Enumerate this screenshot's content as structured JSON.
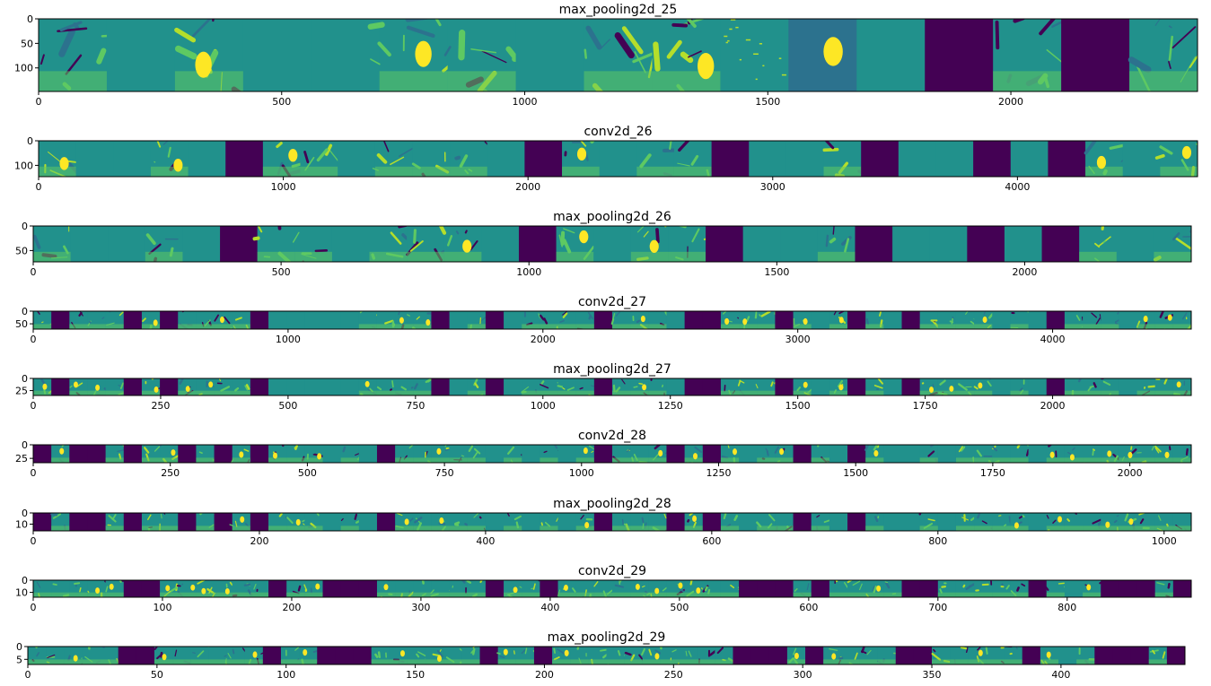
{
  "colors": {
    "dark": "#440154",
    "teal": "#21918c",
    "mid": "#2c728e",
    "green": "#5ec962",
    "lime": "#b5de2b",
    "yellow": "#fde725"
  },
  "chart_data": [
    {
      "type": "heatmap",
      "title": "max_pooling2d_25",
      "xlim": [
        0,
        2384
      ],
      "ylim": [
        148,
        0
      ],
      "xticks": [
        0,
        500,
        1000,
        1500,
        2000
      ],
      "yticks": [
        0,
        50,
        100
      ],
      "panels": [
        "feat",
        "flat",
        "feat",
        "flat",
        "flat",
        "feat",
        "feat",
        "flat",
        "feat",
        "feat",
        "sparse",
        "blob",
        "flat",
        "dark",
        "feat",
        "dark",
        "feat"
      ]
    },
    {
      "type": "heatmap",
      "title": "conv2d_26",
      "xlim": [
        0,
        4736
      ],
      "ylim": [
        146,
        0
      ],
      "xticks": [
        0,
        1000,
        2000,
        3000,
        4000
      ],
      "yticks": [
        0,
        100
      ],
      "panels": [
        "feat",
        "flat",
        "flat",
        "feat",
        "flat",
        "dark",
        "feat",
        "feat",
        "flat",
        "feat",
        "feat",
        "feat",
        "flat",
        "dark",
        "feat",
        "flat",
        "feat",
        "feat",
        "dark",
        "flat",
        "flat",
        "feat",
        "dark",
        "flat",
        "flat",
        "dark",
        "flat",
        "dark",
        "feat",
        "flat",
        "feat"
      ]
    },
    {
      "type": "heatmap",
      "title": "max_pooling2d_26",
      "xlim": [
        0,
        2336
      ],
      "ylim": [
        73,
        0
      ],
      "xticks": [
        0,
        500,
        1000,
        1500,
        2000
      ],
      "yticks": [
        0,
        50
      ],
      "panels": [
        "feat",
        "flat",
        "flat",
        "feat",
        "flat",
        "dark",
        "feat",
        "feat",
        "flat",
        "feat",
        "feat",
        "feat",
        "flat",
        "dark",
        "feat",
        "flat",
        "feat",
        "feat",
        "dark",
        "flat",
        "flat",
        "feat",
        "dark",
        "flat",
        "flat",
        "dark",
        "flat",
        "dark",
        "feat",
        "flat",
        "feat"
      ]
    },
    {
      "type": "heatmap",
      "title": "conv2d_27",
      "xlim": [
        0,
        4544
      ],
      "ylim": [
        71,
        0
      ],
      "xticks": [
        0,
        1000,
        2000,
        3000,
        4000
      ],
      "yticks": [
        0,
        50
      ],
      "panels": [
        "feat",
        "dark",
        "feat",
        "feat",
        "feat",
        "dark",
        "feat",
        "dark",
        "feat",
        "feat",
        "feat",
        "feat",
        "dark",
        "flat",
        "flat",
        "flat",
        "flat",
        "flat",
        "feat",
        "feat",
        "feat",
        "feat",
        "dark",
        "flat",
        "feat",
        "dark",
        "flat",
        "feat",
        "feat",
        "feat",
        "feat",
        "dark",
        "feat",
        "feat",
        "feat",
        "flat",
        "dark",
        "dark",
        "feat",
        "feat",
        "feat",
        "dark",
        "feat",
        "flat",
        "feat",
        "dark",
        "feat",
        "flat",
        "dark",
        "feat",
        "feat",
        "feat",
        "feat",
        "flat",
        "feat",
        "flat",
        "dark",
        "feat",
        "feat",
        "feat",
        "flat",
        "feat",
        "feat",
        "feat"
      ]
    },
    {
      "type": "heatmap",
      "title": "max_pooling2d_27",
      "xlim": [
        0,
        2272
      ],
      "ylim": [
        35,
        0
      ],
      "xticks": [
        0,
        250,
        500,
        750,
        1000,
        1250,
        1500,
        1750,
        2000
      ],
      "yticks": [
        0,
        25
      ],
      "panels": [
        "feat",
        "dark",
        "feat",
        "feat",
        "feat",
        "dark",
        "feat",
        "dark",
        "feat",
        "feat",
        "feat",
        "feat",
        "dark",
        "flat",
        "flat",
        "flat",
        "flat",
        "flat",
        "feat",
        "feat",
        "feat",
        "feat",
        "dark",
        "flat",
        "feat",
        "dark",
        "flat",
        "feat",
        "feat",
        "feat",
        "feat",
        "dark",
        "feat",
        "feat",
        "feat",
        "flat",
        "dark",
        "dark",
        "feat",
        "feat",
        "feat",
        "dark",
        "feat",
        "flat",
        "feat",
        "dark",
        "feat",
        "flat",
        "dark",
        "feat",
        "feat",
        "feat",
        "feat",
        "flat",
        "feat",
        "flat",
        "dark",
        "feat",
        "feat",
        "feat",
        "flat",
        "feat",
        "feat",
        "feat"
      ]
    },
    {
      "type": "heatmap",
      "title": "conv2d_28",
      "xlim": [
        0,
        2112
      ],
      "ylim": [
        33,
        0
      ],
      "xticks": [
        0,
        250,
        500,
        750,
        1000,
        1250,
        1500,
        1750,
        2000
      ],
      "yticks": [
        0,
        25
      ],
      "panels": [
        "dark",
        "feat",
        "dark",
        "dark",
        "feat",
        "dark",
        "feat",
        "feat",
        "dark",
        "feat",
        "dark",
        "feat",
        "dark",
        "feat",
        "feat",
        "feat",
        "flat",
        "feat",
        "flat",
        "dark",
        "feat",
        "feat",
        "feat",
        "feat",
        "feat",
        "flat",
        "feat",
        "flat",
        "feat",
        "flat",
        "feat",
        "dark",
        "feat",
        "feat",
        "feat",
        "dark",
        "feat",
        "dark",
        "feat",
        "flat",
        "feat",
        "feat",
        "dark",
        "feat",
        "flat",
        "dark",
        "feat",
        "flat",
        "flat",
        "feat",
        "flat",
        "feat",
        "feat",
        "feat",
        "feat",
        "flat",
        "feat",
        "feat",
        "feat",
        "feat",
        "feat",
        "feat",
        "feat",
        "feat"
      ]
    },
    {
      "type": "heatmap",
      "title": "max_pooling2d_28",
      "xlim": [
        0,
        1024
      ],
      "ylim": [
        16,
        0
      ],
      "xticks": [
        0,
        200,
        400,
        600,
        800,
        1000
      ],
      "yticks": [
        0,
        10
      ],
      "panels": [
        "dark",
        "feat",
        "dark",
        "dark",
        "feat",
        "dark",
        "feat",
        "feat",
        "dark",
        "feat",
        "dark",
        "feat",
        "dark",
        "feat",
        "feat",
        "feat",
        "flat",
        "feat",
        "flat",
        "dark",
        "feat",
        "feat",
        "feat",
        "feat",
        "feat",
        "flat",
        "feat",
        "flat",
        "feat",
        "flat",
        "feat",
        "dark",
        "feat",
        "feat",
        "feat",
        "dark",
        "feat",
        "dark",
        "feat",
        "flat",
        "feat",
        "feat",
        "dark",
        "feat",
        "flat",
        "dark",
        "feat",
        "flat",
        "flat",
        "feat",
        "flat",
        "feat",
        "feat",
        "feat",
        "feat",
        "flat",
        "feat",
        "feat",
        "feat",
        "feat",
        "feat",
        "feat",
        "feat",
        "feat"
      ]
    },
    {
      "type": "heatmap",
      "title": "conv2d_29",
      "xlim": [
        0,
        896
      ],
      "ylim": [
        14,
        0
      ],
      "xticks": [
        0,
        100,
        200,
        300,
        400,
        500,
        600,
        700,
        800
      ],
      "yticks": [
        0,
        10
      ],
      "panels": [
        "feat",
        "feat",
        "feat",
        "feat",
        "feat",
        "dark",
        "dark",
        "feat",
        "feat",
        "feat",
        "feat",
        "feat",
        "feat",
        "dark",
        "feat",
        "feat",
        "dark",
        "dark",
        "dark",
        "feat",
        "feat",
        "feat",
        "feat",
        "feat",
        "feat",
        "dark",
        "feat",
        "feat",
        "dark",
        "feat",
        "feat",
        "feat",
        "feat",
        "feat",
        "feat",
        "feat",
        "feat",
        "feat",
        "feat",
        "dark",
        "dark",
        "dark",
        "feat",
        "dark",
        "feat",
        "feat",
        "feat",
        "feat",
        "dark",
        "dark",
        "feat",
        "feat",
        "feat",
        "feat",
        "feat",
        "dark",
        "feat",
        "flat",
        "feat",
        "dark",
        "dark",
        "dark",
        "feat",
        "dark"
      ]
    },
    {
      "type": "heatmap",
      "title": "max_pooling2d_29",
      "xlim": [
        0,
        448
      ],
      "ylim": [
        7,
        0
      ],
      "xticks": [
        0,
        50,
        100,
        150,
        200,
        250,
        300,
        350,
        400
      ],
      "yticks": [
        0,
        5
      ],
      "panels": [
        "feat",
        "feat",
        "feat",
        "feat",
        "feat",
        "dark",
        "dark",
        "feat",
        "feat",
        "feat",
        "feat",
        "feat",
        "feat",
        "dark",
        "feat",
        "feat",
        "dark",
        "dark",
        "dark",
        "feat",
        "feat",
        "feat",
        "feat",
        "feat",
        "feat",
        "dark",
        "feat",
        "feat",
        "dark",
        "feat",
        "feat",
        "feat",
        "feat",
        "feat",
        "feat",
        "feat",
        "feat",
        "feat",
        "feat",
        "dark",
        "dark",
        "dark",
        "feat",
        "dark",
        "feat",
        "feat",
        "feat",
        "feat",
        "dark",
        "dark",
        "feat",
        "feat",
        "feat",
        "feat",
        "feat",
        "dark",
        "feat",
        "flat",
        "feat",
        "dark",
        "dark",
        "dark",
        "feat",
        "dark"
      ]
    }
  ]
}
